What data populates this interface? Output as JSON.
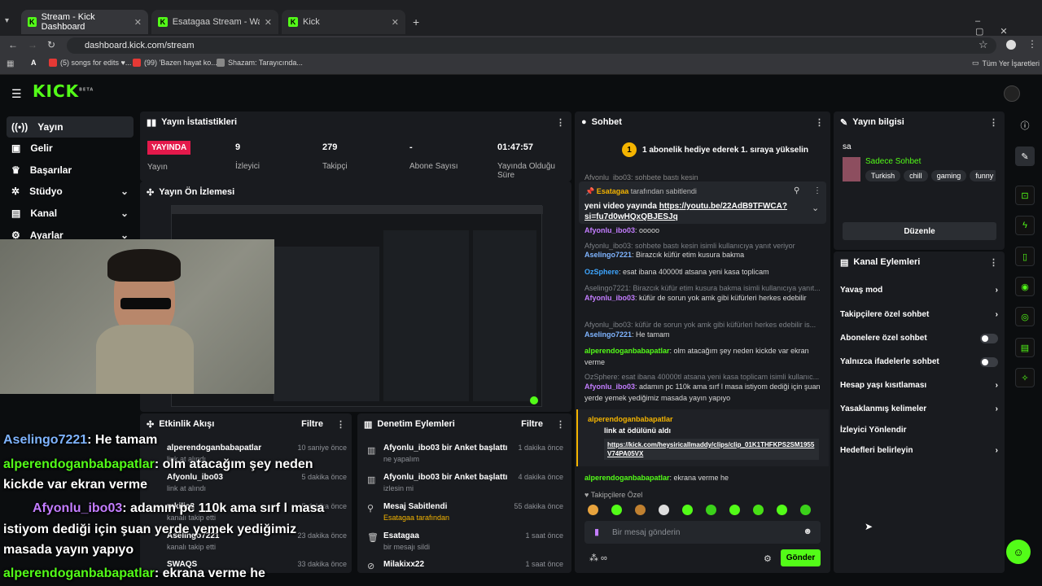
{
  "browser": {
    "tabs": [
      {
        "label": "Stream - Kick Dashboard"
      },
      {
        "label": "Esatagaa Stream - Watch Live o"
      },
      {
        "label": "Kick"
      }
    ],
    "url": "dashboard.kick.com/stream",
    "bookmarks": [
      "A",
      "(5) songs for edits ♥...",
      "(99) 'Bazen hayat ko...",
      "Shazam: Tarayıcında..."
    ],
    "all_bookmarks": "Tüm Yer İşaretleri"
  },
  "kick": {
    "logo": "KICK",
    "beta": "BETA"
  },
  "sidebar": {
    "items": [
      {
        "label": "Yayın"
      },
      {
        "label": "Gelir"
      },
      {
        "label": "Başarılar"
      },
      {
        "label": "Stüdyo"
      },
      {
        "label": "Kanal"
      },
      {
        "label": "Ayarlar"
      }
    ]
  },
  "stats": {
    "title": "Yayın İstatistikleri",
    "live_badge": "YAYINDA",
    "live_label": "Yayın",
    "viewers": "9",
    "viewers_label": "İzleyici",
    "followers": "279",
    "followers_label": "Takipçi",
    "subs": "-",
    "subs_label": "Abone Sayısı",
    "uptime": "01:47:57",
    "uptime_label": "Yayında Olduğu Süre"
  },
  "preview": {
    "title": "Yayın Ön İzlemesi"
  },
  "chat": {
    "title": "Sohbet",
    "promo": "1 abonelik hediye ederek 1. sıraya yükselin",
    "top_cut": "Afyonlu_ibo03: sohbete bastı kesin",
    "pinned_by": "Esatagaa",
    "pinned_suffix": "tarafından sabitlendi",
    "pinned_text": "yeni video yayında",
    "pinned_link": "https://youtu.be/22AdB9TFWCA?si=fu7d0wHQxQBJESJq",
    "messages": [
      {
        "user": "Afyonlu_ibo03",
        "text": ": ooooo"
      },
      {
        "reply": "Afyonlu_ibo03: sohbete bastı kesin isimli kullanıcıya yanıt veriyor"
      },
      {
        "user": "Aselingo7221",
        "text": ": Birazcık küfür etim kusura bakma"
      },
      {
        "user": "OzSphere",
        "text": ": esat ibana 40000tl atsana yeni kasa toplicam"
      },
      {
        "reply": "Aselingo7221: Birazcık küfür etim kusura bakma isimli kullanıcıya yanıt..."
      },
      {
        "user": "Afyonlu_ibo03",
        "text": ": küfür de sorun yok amk gibi küfürleri herkes edebilir"
      },
      {
        "reply": "Afyonlu_ibo03: küfür de sorun yok amk gibi küfürleri herkes edebilir is..."
      },
      {
        "user": "Aselingo7221",
        "text": ": He tamam"
      },
      {
        "user": "alperendoganbabapatlar",
        "text": ": olm atacağım şey neden kickde var ekran verme"
      },
      {
        "reply": "OzSphere: esat ibana 40000tl atsana yeni kasa toplicam isimli kullanıc..."
      },
      {
        "user": "Afyonlu_ibo03",
        "text": ": adamın pc 110k ama sırf l masa istiyom dediği için şuan yerde yemek yediğimiz masada yayın yapıyo"
      }
    ],
    "clip_user": "alperendoganbabapatlar",
    "clip_text": "link at ödülünü aldı",
    "clip_link": "https://kick.com/heysiricallmaddy/clips/clip_01K1THFKPS2SM1955V74PA05VX",
    "last_user": "alperendoganbabapatlar",
    "last_text": ": ekrana verme he",
    "followers_only": "Takipçilere Özel",
    "input_placeholder": "Bir mesaj gönderin",
    "send": "Gönder"
  },
  "stream_info": {
    "title": "Yayın bilgisi",
    "stream_title": "sa",
    "category": "Sadece Sohbet",
    "tags": [
      "Turkish",
      "chill",
      "gaming",
      "funny"
    ],
    "edit": "Düzenle"
  },
  "channel_actions": {
    "title": "Kanal Eylemleri",
    "items": [
      {
        "label": "Yavaş mod",
        "kind": "chevron"
      },
      {
        "label": "Takipçilere özel sohbet",
        "kind": "chevron"
      },
      {
        "label": "Abonelere özel sohbet",
        "kind": "toggle"
      },
      {
        "label": "Yalnızca ifadelerle sohbet",
        "kind": "toggle"
      },
      {
        "label": "Hesap yaşı kısıtlaması",
        "kind": "chevron"
      },
      {
        "label": "Yasaklanmış kelimeler",
        "kind": "chevron"
      },
      {
        "label": "İzleyici Yönlendir",
        "kind": "none"
      },
      {
        "label": "Hedefleri belirleyin",
        "kind": "chevron"
      }
    ]
  },
  "activity": {
    "title": "Etkinlik Akışı",
    "filter": "Filtre",
    "items": [
      {
        "user": "alperendoganbabapatlar",
        "sub": "link at alındı",
        "time": "10 saniye önce"
      },
      {
        "user": "Afyonlu_ibo03",
        "sub": "link at alındı",
        "time": "5 dakika önce"
      },
      {
        "user": "mkilic2",
        "sub": "kanalı takip etti",
        "time": "5 dakika önce"
      },
      {
        "user": "Aselingo7221",
        "sub": "kanalı takip etti",
        "time": "23 dakika önce"
      },
      {
        "user": "SWAQS",
        "sub": "",
        "time": "33 dakika önce"
      }
    ]
  },
  "moderation": {
    "title": "Denetim Eylemleri",
    "filter": "Filtre",
    "items": [
      {
        "main": "Afyonlu_ibo03 bir Anket başlattı",
        "sub": "ne yapalım",
        "time": "1 dakika önce"
      },
      {
        "main": "Afyonlu_ibo03 bir Anket başlattı",
        "sub": "izlesin mi",
        "time": "4 dakika önce"
      },
      {
        "main": "Mesaj Sabitlendi",
        "sub": "Esatagaa tarafından",
        "time": "55 dakika önce"
      },
      {
        "main": "Esatagaa",
        "sub": "bir mesajı sildi",
        "time": "1 saat önce"
      },
      {
        "main": "Milakixx22",
        "sub": "",
        "time": "1 saat önce"
      }
    ]
  },
  "overlay": {
    "lines": [
      {
        "user": "Aselingo7221",
        "text": ": He tamam"
      },
      {
        "user": "alperendoganbabapatlar",
        "text": ": olm atacağım şey neden"
      },
      {
        "user": "",
        "text": "kickde var ekran verme"
      },
      {
        "user": "Afyonlu_ibo03",
        "text": ": adamın pc 110k ama sırf l masa"
      },
      {
        "user": "",
        "text": "istiyom dediği için şuan yerde yemek yediğimiz"
      },
      {
        "user": "",
        "text": "masada yayın yapıyo"
      },
      {
        "user": "alperendoganbabapatlar",
        "text": ": ekrana verme he"
      }
    ]
  },
  "colors": {
    "brand": "#53fc18",
    "live": "#e4194b",
    "panel": "#191b1f",
    "bg": "#0b0d0f"
  }
}
